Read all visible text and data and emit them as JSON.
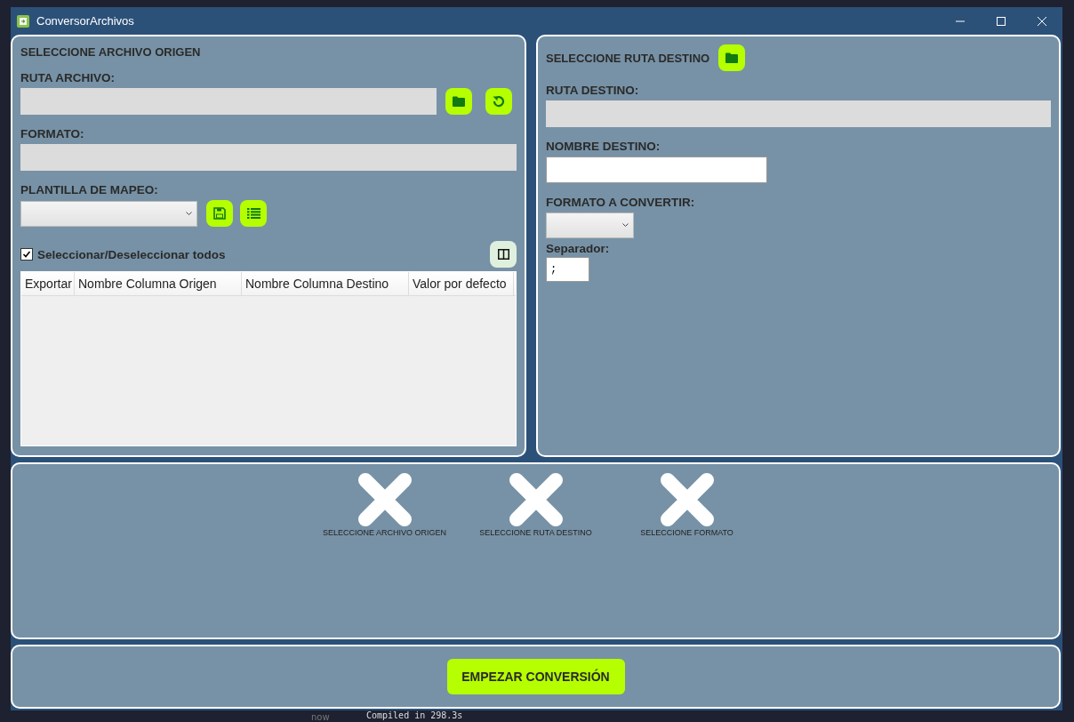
{
  "desktop": {
    "terminal_line": "Compiled in 298.3s",
    "terminal_time": "now"
  },
  "window": {
    "title": "ConversorArchivos"
  },
  "source": {
    "heading": "SELECCIONE ARCHIVO ORIGEN",
    "path_label": "RUTA ARCHIVO:",
    "format_label": "FORMATO:",
    "template_label": "PLANTILLA DE MAPEO:",
    "select_all": {
      "label": "Seleccionar/Deseleccionar todos",
      "checked": true
    },
    "table": {
      "columns": [
        "Exportar",
        "Nombre Columna Origen",
        "Nombre Columna Destino",
        "Valor por defecto"
      ]
    }
  },
  "destination": {
    "heading": "SELECCIONE RUTA DESTINO",
    "path_label": "RUTA DESTINO:",
    "name_label": "NOMBRE DESTINO:",
    "format_label": "FORMATO A CONVERTIR:",
    "separator_label": "Separador:",
    "separator": {
      "value": ";"
    }
  },
  "status": [
    {
      "label": "SELECCIONE ARCHIVO ORIGEN",
      "ok": false
    },
    {
      "label": "SELECCIONE RUTA DESTINO",
      "ok": false
    },
    {
      "label": "SELECCIONE FORMATO",
      "ok": false
    }
  ],
  "start_button": "EMPEZAR CONVERSIÓN"
}
